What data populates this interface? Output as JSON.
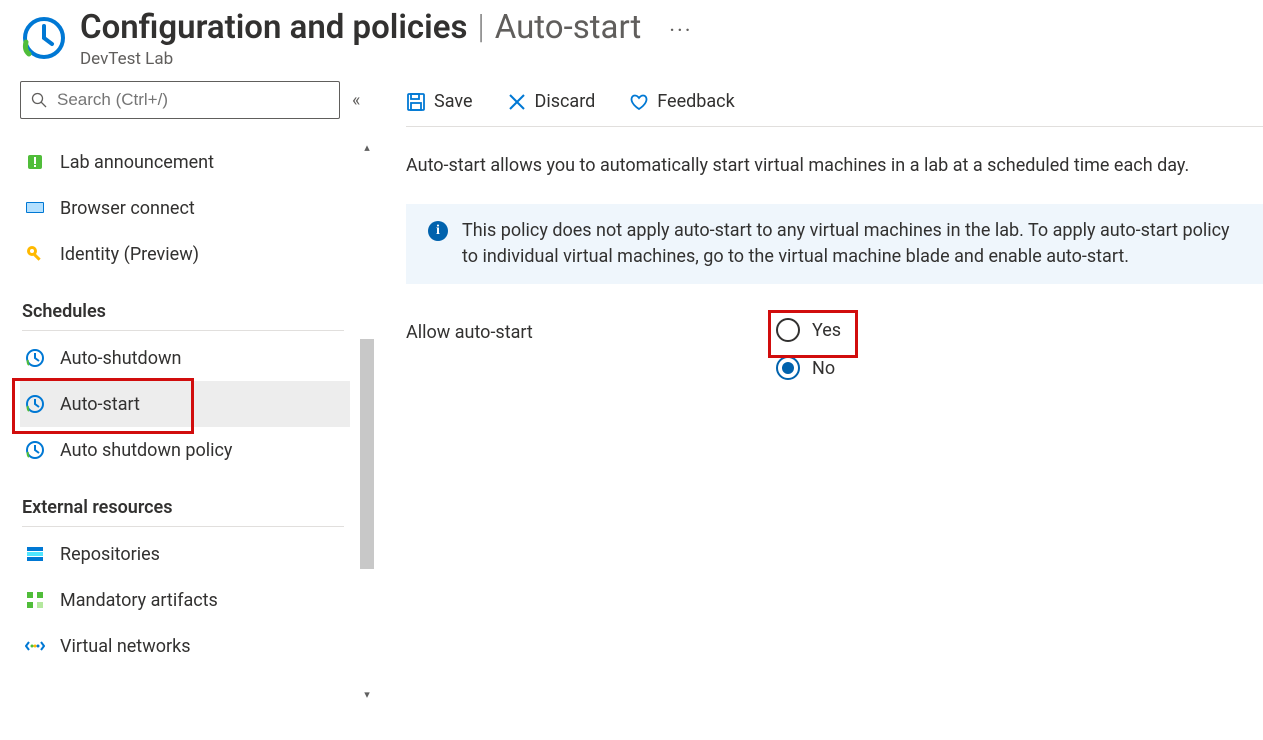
{
  "header": {
    "title": "Configuration and policies",
    "separator": "|",
    "subtitle": "Auto-start",
    "caption": "DevTest Lab",
    "more_label": "···"
  },
  "search": {
    "placeholder": "Search (Ctrl+/)"
  },
  "sidebar": {
    "items": [
      {
        "id": "lab-announcement",
        "label": "Lab announcement",
        "icon": "announce"
      },
      {
        "id": "browser-connect",
        "label": "Browser connect",
        "icon": "monitor"
      },
      {
        "id": "identity-preview",
        "label": "Identity (Preview)",
        "icon": "key"
      }
    ],
    "section_schedules": "Schedules",
    "schedules": [
      {
        "id": "auto-shutdown",
        "label": "Auto-shutdown",
        "icon": "clock"
      },
      {
        "id": "auto-start",
        "label": "Auto-start",
        "icon": "clock",
        "selected": true,
        "highlight": true
      },
      {
        "id": "auto-shutdown-policy",
        "label": "Auto shutdown policy",
        "icon": "clock"
      }
    ],
    "section_external": "External resources",
    "external": [
      {
        "id": "repositories",
        "label": "Repositories",
        "icon": "repo"
      },
      {
        "id": "mandatory-artifacts",
        "label": "Mandatory artifacts",
        "icon": "artifacts"
      },
      {
        "id": "virtual-networks",
        "label": "Virtual networks",
        "icon": "vnet"
      }
    ]
  },
  "toolbar": {
    "save": "Save",
    "discard": "Discard",
    "feedback": "Feedback"
  },
  "main": {
    "description": "Auto-start allows you to automatically start virtual machines in a lab at a scheduled time each day.",
    "info": "This policy does not apply auto-start to any virtual machines in the lab. To apply auto-start policy to individual virtual machines, go to the virtual machine blade and enable auto-start.",
    "form": {
      "allow_label": "Allow auto-start",
      "options": {
        "yes": "Yes",
        "no": "No"
      },
      "selected": "no"
    }
  },
  "colors": {
    "accent": "#0062ad",
    "highlight": "#d10d0d"
  }
}
